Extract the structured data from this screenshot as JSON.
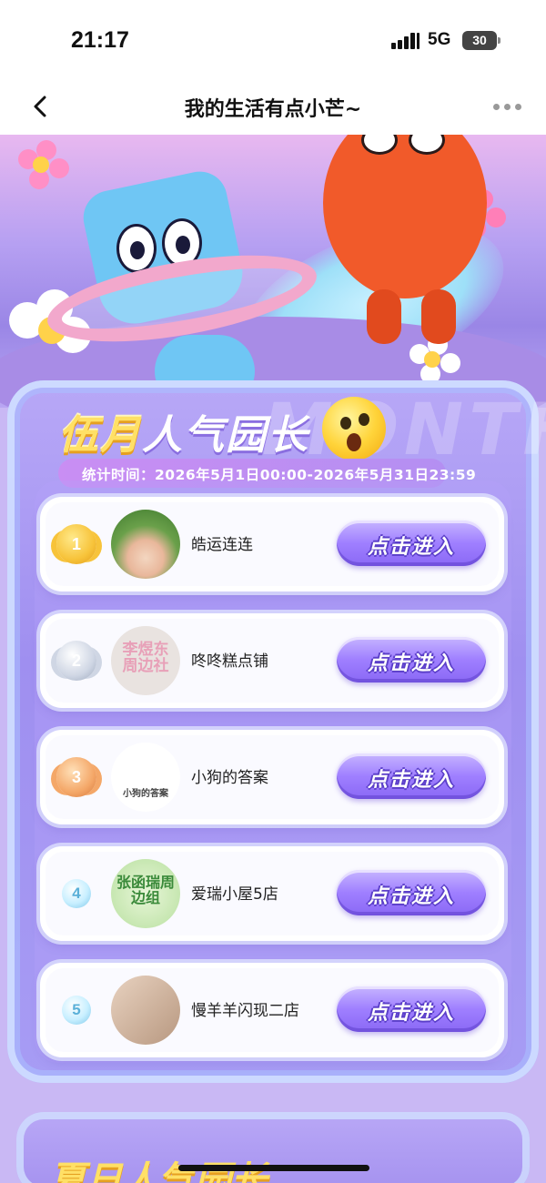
{
  "status_bar": {
    "time": "21:17",
    "network": "5G",
    "battery": "30"
  },
  "nav": {
    "title": "我的生活有点小芒~"
  },
  "panel": {
    "title_highlight": "伍月",
    "title_rest": "人气园长",
    "watermark": "MONTH",
    "stat_period": "统计时间：2026年5月1日00:00-2026年5月31日23:59"
  },
  "ranking": [
    {
      "rank": "1",
      "medal": "gold",
      "name": "皓运连连",
      "button": "点击进入"
    },
    {
      "rank": "2",
      "medal": "silver",
      "name": "咚咚糕点铺",
      "button": "点击进入"
    },
    {
      "rank": "3",
      "medal": "bronze",
      "name": "小狗的答案",
      "button": "点击进入"
    },
    {
      "rank": "4",
      "medal": "plain",
      "name": "爱瑞小屋5店",
      "button": "点击进入"
    },
    {
      "rank": "5",
      "medal": "plain",
      "name": "慢羊羊闪现二店",
      "button": "点击进入"
    }
  ],
  "avatars": {
    "avatar_2_text": "李煜东周边社",
    "avatar_3_text": "小狗的答案",
    "avatar_4_text": "张函瑞周边组"
  },
  "next_section": {
    "title": "夏日人气园长"
  },
  "colors": {
    "button": "#9f7fff",
    "panel": "#a99af2",
    "title_gold": "#ffe066"
  }
}
